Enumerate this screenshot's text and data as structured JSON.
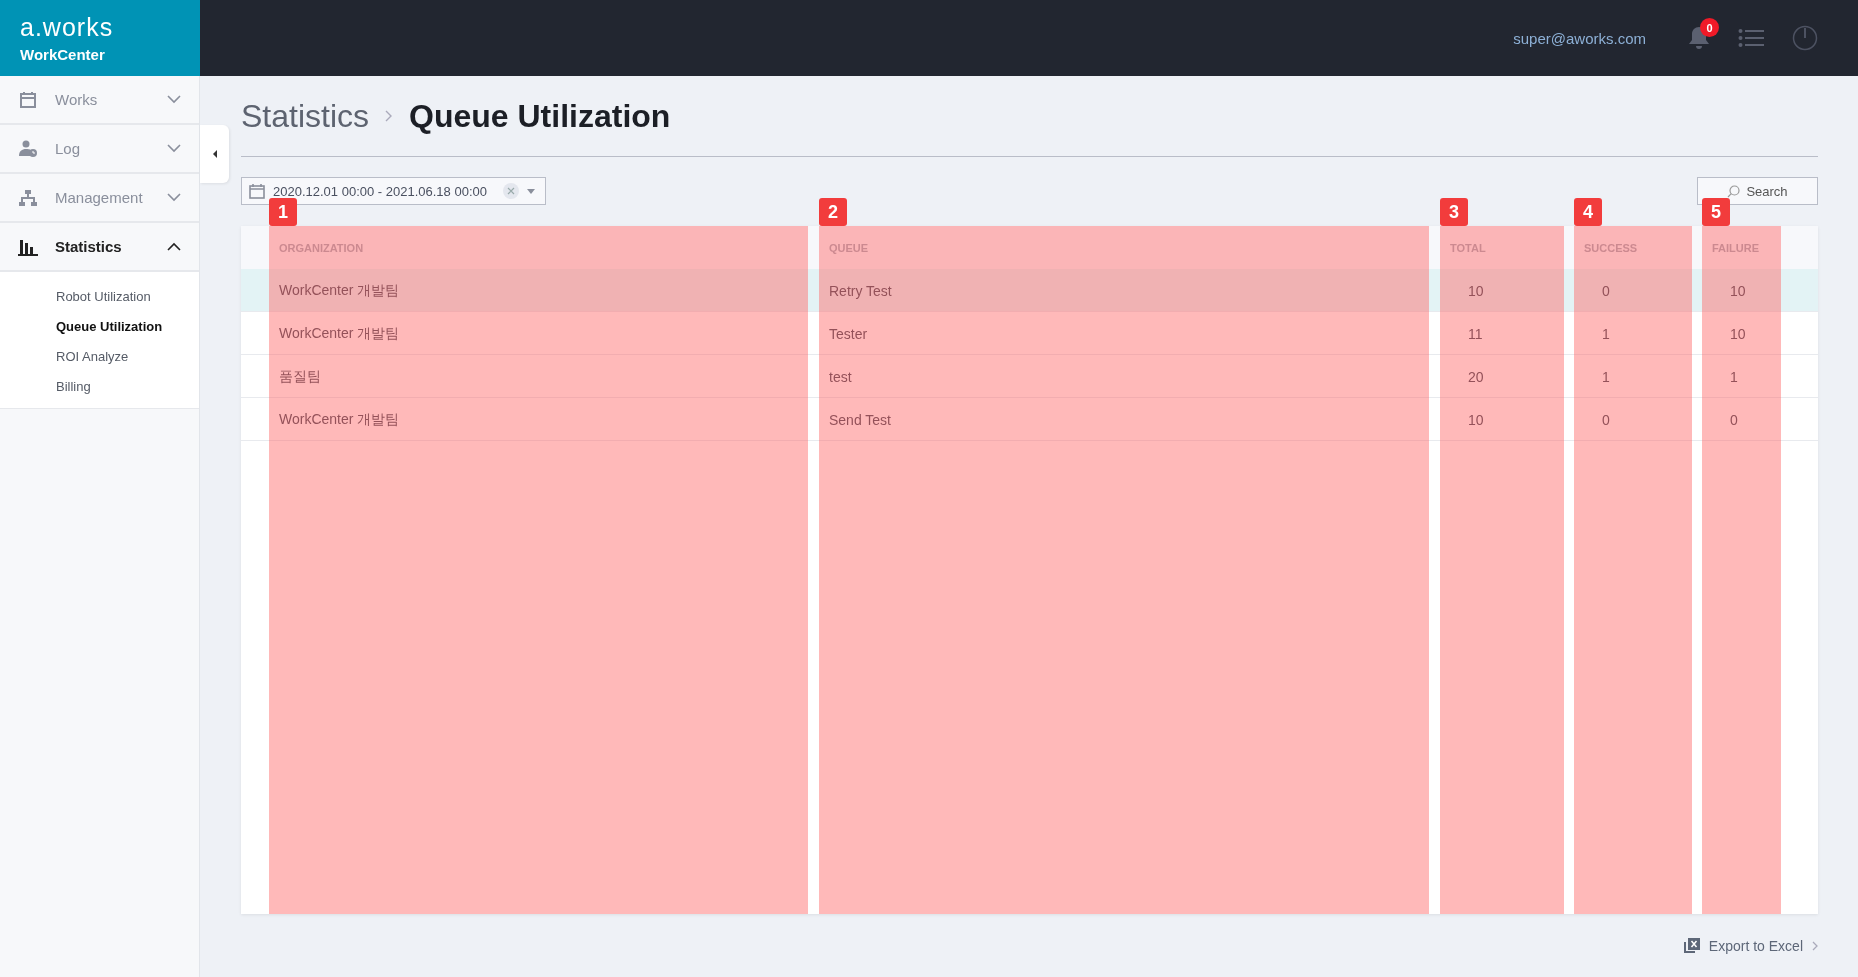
{
  "header": {
    "logo": "a.works",
    "product": "WorkCenter",
    "user": "super@aworks.com",
    "notification_count": "0"
  },
  "sidebar": {
    "items": [
      {
        "label": "Works",
        "expanded": false,
        "selected": false
      },
      {
        "label": "Log",
        "expanded": false,
        "selected": false
      },
      {
        "label": "Management",
        "expanded": false,
        "selected": false
      },
      {
        "label": "Statistics",
        "expanded": true,
        "selected": true,
        "children": [
          {
            "label": "Robot Utilization",
            "selected": false
          },
          {
            "label": "Queue Utilization",
            "selected": true
          },
          {
            "label": "ROI Analyze",
            "selected": false
          },
          {
            "label": "Billing",
            "selected": false
          }
        ]
      }
    ]
  },
  "breadcrumb": [
    "Statistics",
    "Queue Utilization"
  ],
  "filter": {
    "date_range": "2020.12.01 00:00 - 2021.06.18 00:00"
  },
  "search_button": "Search",
  "table": {
    "columns": [
      {
        "label": "ORGANIZATION",
        "marker": "1"
      },
      {
        "label": "QUEUE",
        "marker": "2"
      },
      {
        "label": "TOTAL",
        "marker": "3"
      },
      {
        "label": "SUCCESS",
        "marker": "4"
      },
      {
        "label": "FAILURE",
        "marker": "5"
      }
    ],
    "rows": [
      {
        "selected": true,
        "cells": [
          "WorkCenter 개발팀",
          "Retry Test",
          "10",
          "0",
          "10"
        ]
      },
      {
        "selected": false,
        "cells": [
          "WorkCenter 개발팀",
          "Tester",
          "11",
          "1",
          "10"
        ]
      },
      {
        "selected": false,
        "cells": [
          "품질팀",
          "test",
          "20",
          "1",
          "1"
        ]
      },
      {
        "selected": false,
        "cells": [
          "WorkCenter 개발팀",
          "Send Test",
          "10",
          "0",
          "0"
        ]
      }
    ]
  },
  "export_link": "Export to Excel"
}
